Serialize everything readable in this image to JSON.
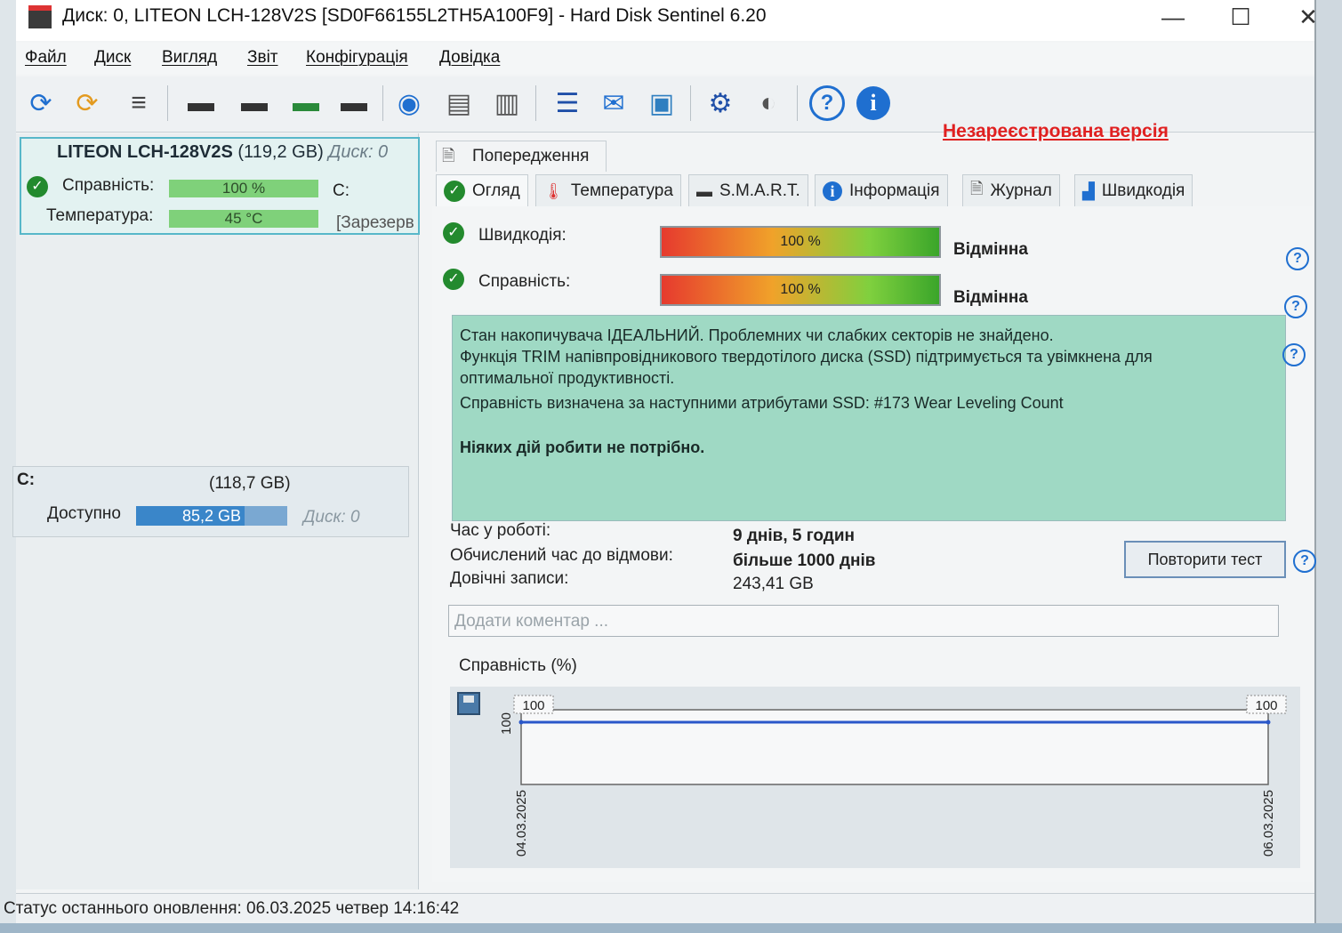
{
  "window": {
    "title": "Диск: 0, LITEON LCH-128V2S [SD0F66155L2TH5A100F9]  -  Hard Disk Sentinel 6.20",
    "controls": {
      "minimize": "—",
      "maximize": "☐",
      "close": "✕"
    }
  },
  "menu": [
    "Файл",
    "Диск",
    "Вигляд",
    "Звіт",
    "Конфігурація",
    "Довідка"
  ],
  "toolbar": {
    "icons": [
      "refresh-icon",
      "refresh-warning-icon",
      "list-icon",
      "disk-tool-icon",
      "disk-schedule-icon",
      "disk-check-icon",
      "disk-search-icon",
      "network-disk-icon",
      "disk-stack-icon",
      "server-disk-icon",
      "report-icon",
      "mail-icon",
      "network-icon",
      "settings-gear-icon",
      "sound-icon",
      "help-icon",
      "info-icon"
    ],
    "unregistered": "Незареєстрована версія"
  },
  "left": {
    "disk": {
      "name": "LITEON LCH-128V2S",
      "size": "(119,2 GB)",
      "index": "Диск: 0",
      "health_label": "Справність:",
      "health_value": "100 %",
      "health_drive": "C:",
      "temp_label": "Температура:",
      "temp_value": "45 °C",
      "reserved": "[Зарезерв"
    },
    "volume": {
      "letter": "C:",
      "size": "(118,7 GB)",
      "free_label": "Доступно",
      "free_value": "85,2 GB",
      "free_fraction": 0.72,
      "disk": "Диск: 0"
    }
  },
  "tabs": {
    "warnings": "Попередження",
    "overview": "Огляд",
    "temperature": "Температура",
    "smart": "S.M.A.R.T.",
    "info": "Інформація",
    "log": "Журнал",
    "speed": "Швидкодія"
  },
  "overview": {
    "performance_label": "Швидкодія:",
    "performance_value": "100 %",
    "performance_verdict": "Відмінна",
    "health_label": "Справність:",
    "health_value": "100 %",
    "health_verdict": "Відмінна",
    "status_lines": [
      "Стан накопичувача ІДЕАЛЬНИЙ. Проблемних чи слабких секторів не знайдено.",
      "Функція TRIM напівпровідникового твердотілого диска (SSD) підтримується та увімкнена для",
      "оптимальної продуктивності.",
      "Справність визначена за наступними атрибутами SSD:  #173 Wear Leveling Count"
    ],
    "status_action": "Ніяких дій робити не потрібно.",
    "uptime_label": "Час у роботі:",
    "uptime_value": "9 днів, 5 годин",
    "ttf_label": "Обчислений час до відмови:",
    "ttf_value": "більше 1000 днів",
    "writes_label": "Довічні записи:",
    "writes_value": "243,41 GB",
    "retest_button": "Повторити тест",
    "comment_placeholder": "Додати коментар ...",
    "chart_title": "Справність (%)"
  },
  "chart_data": {
    "type": "line",
    "x": [
      "04.03.2025",
      "06.03.2025"
    ],
    "series": [
      {
        "values": [
          100,
          100
        ]
      }
    ],
    "y_tick": "100",
    "point_labels": [
      "100",
      "100"
    ],
    "ylim": [
      0,
      100
    ],
    "color": "#2a57c9"
  },
  "statusbar": {
    "text": "Статус останнього оновлення: 06.03.2025 четвер 14:16:42"
  }
}
